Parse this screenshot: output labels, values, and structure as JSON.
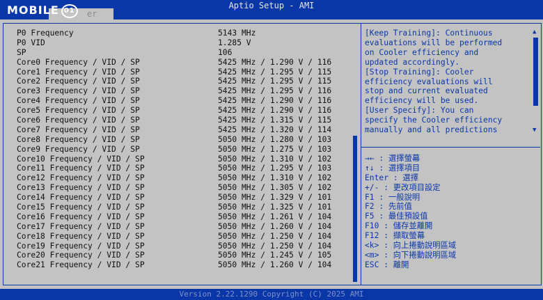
{
  "header": {
    "title": "Aptio Setup - AMI",
    "tab_fragment": "er",
    "logo_text": "MOBILE",
    "logo_mark": "01"
  },
  "rows": [
    {
      "label": "P0 Frequency",
      "value": "5143 MHz"
    },
    {
      "label": "P0 VID",
      "value": "1.285 V"
    },
    {
      "label": "SP",
      "value": "106"
    },
    {
      "label": "Core0 Frequency / VID / SP",
      "value": "5425 MHz / 1.290 V / 116"
    },
    {
      "label": "Core1 Frequency / VID / SP",
      "value": "5425 MHz / 1.295 V / 115"
    },
    {
      "label": "Core2 Frequency / VID / SP",
      "value": "5425 MHz / 1.295 V / 115"
    },
    {
      "label": "Core3 Frequency / VID / SP",
      "value": "5425 MHz / 1.295 V / 116"
    },
    {
      "label": "Core4 Frequency / VID / SP",
      "value": "5425 MHz / 1.290 V / 116"
    },
    {
      "label": "Core5 Frequency / VID / SP",
      "value": "5425 MHz / 1.290 V / 116"
    },
    {
      "label": "Core6 Frequency / VID / SP",
      "value": "5425 MHz / 1.315 V / 115"
    },
    {
      "label": "Core7 Frequency / VID / SP",
      "value": "5425 MHz / 1.320 V / 114"
    },
    {
      "label": "Core8 Frequency / VID / SP",
      "value": "5050 MHz / 1.280 V / 103"
    },
    {
      "label": "Core9 Frequency / VID / SP",
      "value": "5050 MHz / 1.275 V / 103"
    },
    {
      "label": "Core10 Frequency / VID / SP",
      "value": "5050 MHz / 1.310 V / 102"
    },
    {
      "label": "Core11 Frequency / VID / SP",
      "value": "5050 MHz / 1.295 V / 103"
    },
    {
      "label": "Core12 Frequency / VID / SP",
      "value": "5050 MHz / 1.310 V / 102"
    },
    {
      "label": "Core13 Frequency / VID / SP",
      "value": "5050 MHz / 1.305 V / 102"
    },
    {
      "label": "Core14 Frequency / VID / SP",
      "value": "5050 MHz / 1.329 V / 101"
    },
    {
      "label": "Core15 Frequency / VID / SP",
      "value": "5050 MHz / 1.325 V / 101"
    },
    {
      "label": "Core16 Frequency / VID / SP",
      "value": "5050 MHz / 1.261 V / 104"
    },
    {
      "label": "Core17 Frequency / VID / SP",
      "value": "5050 MHz / 1.260 V / 104"
    },
    {
      "label": "Core18 Frequency / VID / SP",
      "value": "5050 MHz / 1.250 V / 104"
    },
    {
      "label": "Core19 Frequency / VID / SP",
      "value": "5050 MHz / 1.250 V / 104"
    },
    {
      "label": "Core20 Frequency / VID / SP",
      "value": "5050 MHz / 1.245 V / 105"
    },
    {
      "label": "Core21 Frequency / VID / SP",
      "value": "5050 MHz / 1.260 V / 104"
    }
  ],
  "help": {
    "text": "[Keep Training]: Continuous\nevaluations will be performed\non Cooler efficiency and\nupdated accordingly.\n[Stop Training]: Cooler\nefficiency evaluations will\nstop and current evaluated\nefficiency will be used.\n[User Specify]: You can\nspecify the Cooler efficiency\nmanually and all predictions",
    "scroll_up": "▲",
    "scroll_down": "▼"
  },
  "keys": [
    "→← : 選擇螢幕",
    "↑↓ : 選擇項目",
    "Enter : 選擇",
    "+/- : 更改項目設定",
    "F1 : 一般說明",
    "F2 : 先前值",
    "F5 : 最佳預設值",
    "F10 : 儲存並離開",
    "F12 : 擷取螢幕",
    "<k> : 向上捲動說明區域",
    "<m> : 向下捲動說明區域",
    "ESC : 離開"
  ],
  "footer": {
    "text": "Version 2.22.1290 Copyright (C) 2025 AMI"
  },
  "colors": {
    "accent": "#0a37a8",
    "background": "#c3c3c3",
    "text": "#101010"
  }
}
